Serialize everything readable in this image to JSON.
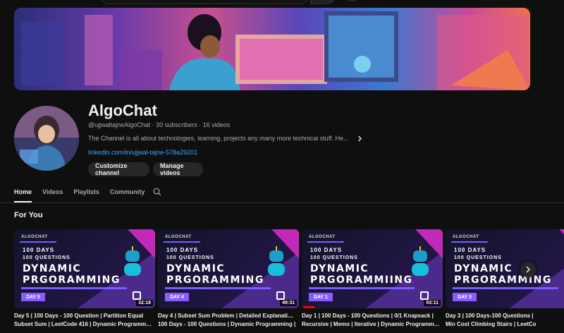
{
  "channel": {
    "name": "AlgoChat",
    "meta": "@ujjwaltajneAlgoChat · 30 subscribers · 16 videos",
    "description": "The Channel is all about technologies, learning, projects any many more technical stuff. He...",
    "link": "linkedin.com/in/ujjwal-tajne-578a29201",
    "customize_label": "Customize channel",
    "manage_label": "Manage videos"
  },
  "tabs": [
    "Home",
    "Videos",
    "Playlists",
    "Community"
  ],
  "active_tab": "Home",
  "section_title": "For You",
  "videos": [
    {
      "day_badge": "DAY 5",
      "duration": "32:18",
      "title_line1": "Day 5 | 100 Days - 100 Question | Partition Equal",
      "title_line2": "Subset Sum | LeetCode 416 | Dynamic Programmin...",
      "watched": 0
    },
    {
      "day_badge": "DAY 4",
      "duration": "49:31",
      "title_line1": "Day 4 | Subset Sum Problem | Detailed Explanation |",
      "title_line2": "100 Days - 100 Questions | Dynamic Programming |",
      "watched": 0
    },
    {
      "day_badge": "DAY 1",
      "duration": "53:11",
      "title_line1": "Day 1 | 100 Days - 100 Questions | 0/1 Knapsack |",
      "title_line2": "Recursive | Memo | Iterative | Dynamic Programming",
      "watched": 0.09
    },
    {
      "day_badge": "DAY 3",
      "duration": "",
      "title_line1": "Day 3 | 100 Days-100 Questions |",
      "title_line2": "Min Cost Climbing Stairs | LeetCo",
      "watched": 0
    }
  ],
  "thumb": {
    "brand": "ALGOCHAT",
    "line1": "100 DAYS",
    "line2": "100 QUESTIONS",
    "line3": "DYNAMIC",
    "line4": "PRGORAMMING",
    "line4_alt": "PRGORAMMIING"
  },
  "icons": {
    "search": "search-icon",
    "chevron_right": "chevron-right-icon",
    "next": "chevron-right-icon"
  },
  "colors": {
    "background": "#0f0f0f",
    "link": "#3ea6ff",
    "button_bg": "#272727",
    "progress": "#ff0000"
  }
}
